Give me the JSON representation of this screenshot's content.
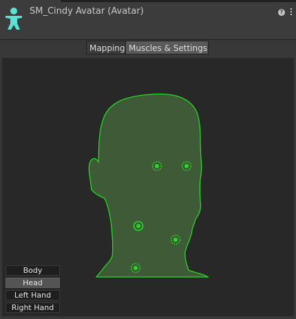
{
  "header": {
    "title": "SM_Cindy Avatar (Avatar)",
    "help_icon": "question-icon",
    "menu_icon": "kebab-menu-icon"
  },
  "tabs": [
    {
      "label": "Mapping",
      "active": false
    },
    {
      "label": "Muscles & Settings",
      "active": true
    }
  ],
  "view": {
    "mode": "Head",
    "modes": [
      "Body",
      "Head",
      "Left Hand",
      "Right Hand"
    ]
  },
  "colors": {
    "accent_green": "#22dd22",
    "head_fill": "#3e5a36",
    "avatar_icon": "#58e4d4"
  }
}
